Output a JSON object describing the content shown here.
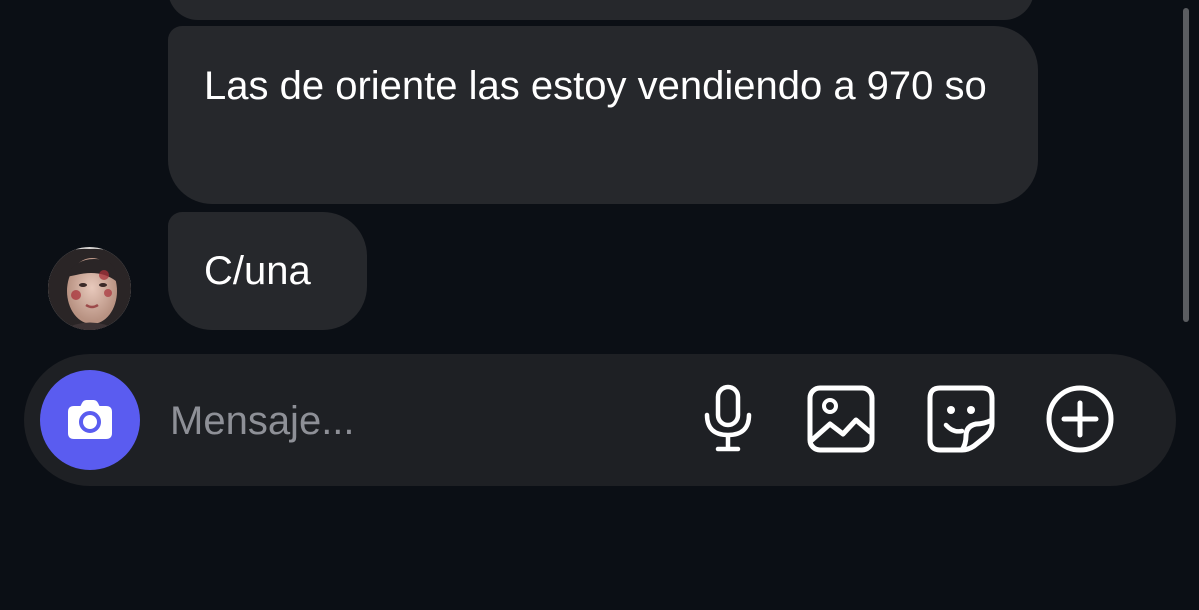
{
  "messages": [
    {
      "text": "Las de oriente las estoy vendiendo a 970 so"
    },
    {
      "text": "C/una"
    }
  ],
  "composer": {
    "placeholder": "Mensaje...",
    "accent_color": "#5a5cf0",
    "icons": [
      "camera-icon",
      "microphone-icon",
      "gallery-icon",
      "sticker-icon",
      "plus-circle-icon"
    ]
  },
  "colors": {
    "background": "#0b0f15",
    "bubble": "#26282c",
    "composer": "#1e2024"
  }
}
